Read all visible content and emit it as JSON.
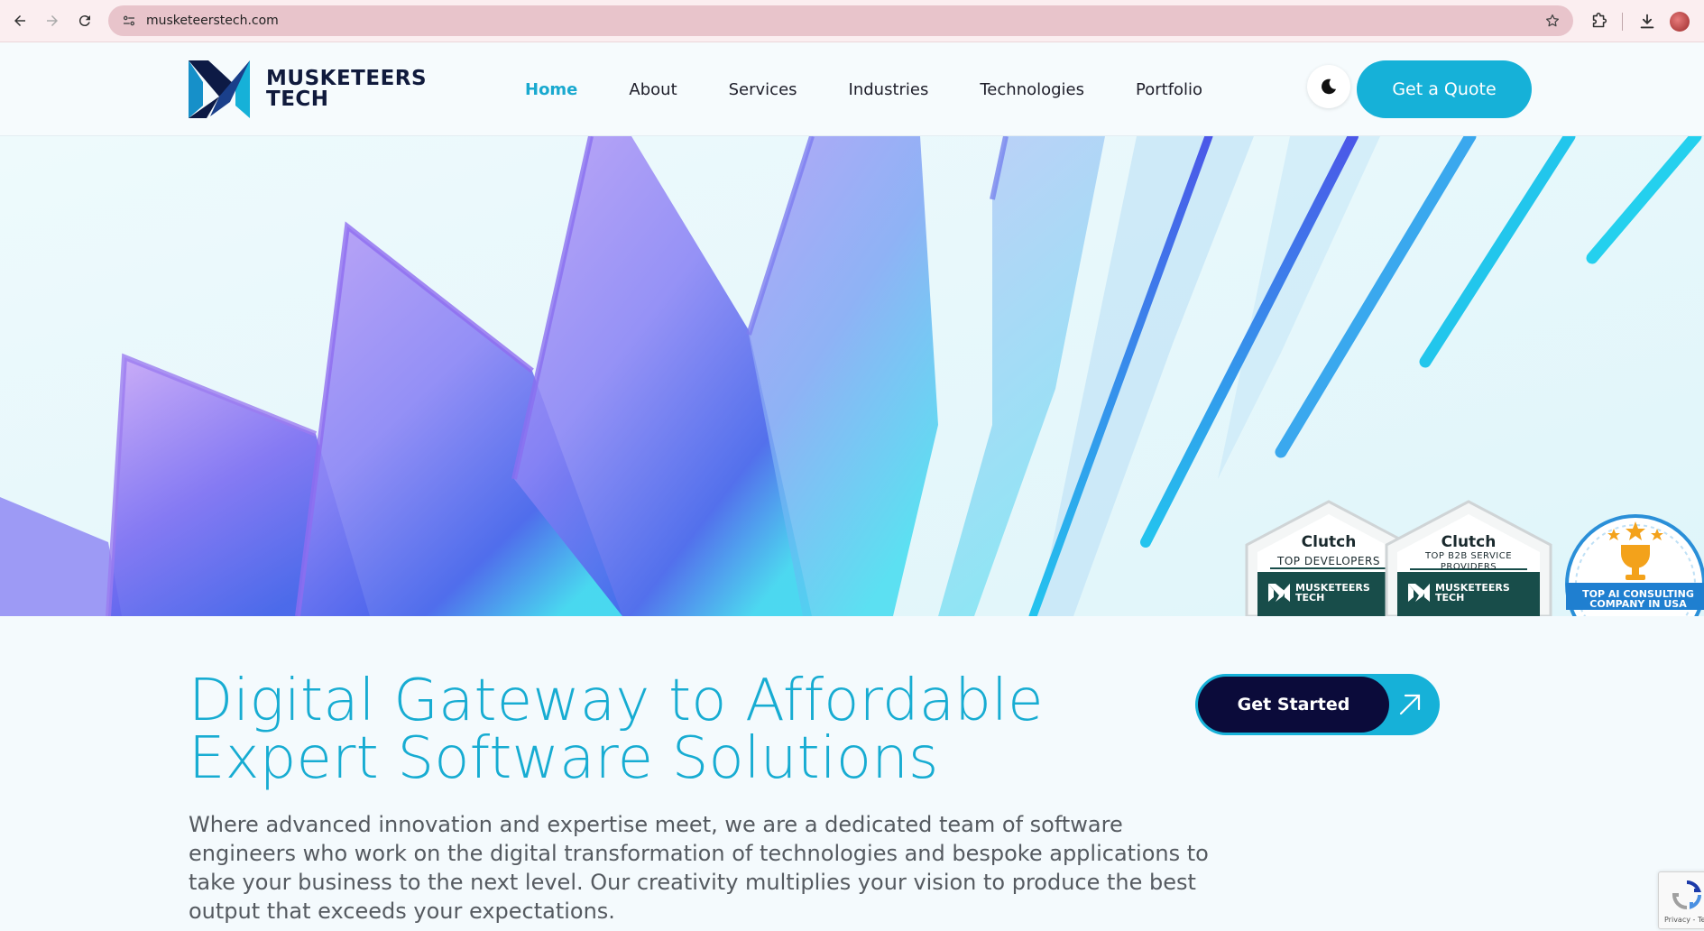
{
  "browser": {
    "url": "musketeerstech.com"
  },
  "header": {
    "logo_line1": "MUSKETEERS",
    "logo_line2": "TECH",
    "nav": [
      {
        "label": "Home",
        "active": true
      },
      {
        "label": "About"
      },
      {
        "label": "Services"
      },
      {
        "label": "Industries"
      },
      {
        "label": "Technologies"
      },
      {
        "label": "Portfolio"
      }
    ],
    "theme_toggle_icon": "moon-icon",
    "quote_label": "Get a Quote"
  },
  "badges": [
    {
      "title": "Clutch",
      "subtitle": "TOP DEVELOPERS",
      "brand1": "MUSKETEERS",
      "brand2": "TECH"
    },
    {
      "title": "Clutch",
      "subtitle": "TOP B2B SERVICE PROVIDERS",
      "brand1": "MUSKETEERS",
      "brand2": "TECH"
    },
    {
      "award_line1": "TOP AI CONSULTING",
      "award_line2": "COMPANY IN USA"
    }
  ],
  "hero": {
    "title_line1": "Digital Gateway to Affordable",
    "title_line2": "Expert Software Solutions",
    "description": "Where advanced innovation and expertise meet, we are a dedicated team of software engineers who work on the digital transformation of technologies and bespoke applications to take your business to the next level. Our creativity multiplies your vision to produce the best output that exceeds your expectations.",
    "cta_label": "Get Started"
  },
  "recaptcha": {
    "text": "Privacy - Te"
  },
  "colors": {
    "accent": "#16b1d8",
    "navy": "#0b0b3a",
    "browser_bar": "#fbeef0",
    "address_bar": "#e8c4cb"
  }
}
